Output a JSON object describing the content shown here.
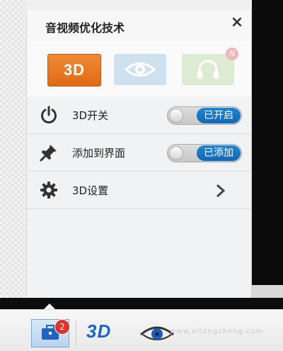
{
  "panel": {
    "title": "音视频优化技术",
    "close_label": "×",
    "tiles": [
      {
        "label": "3D",
        "icon": "3d-icon",
        "state": "active"
      },
      {
        "icon": "eye-icon",
        "state": "inactive"
      },
      {
        "icon": "headphones-icon",
        "state": "inactive",
        "badge": "N"
      }
    ],
    "rows": [
      {
        "icon": "power-icon",
        "label": "3D开关",
        "toggle_label": "已开启",
        "toggle_on": true
      },
      {
        "icon": "pin-icon",
        "label": "添加到界面",
        "toggle_label": "已添加",
        "toggle_on": true
      },
      {
        "icon": "gear-icon",
        "label": "3D设置",
        "action": "chevron-right-icon"
      }
    ]
  },
  "taskbar": {
    "badge_count": "2",
    "item_3d_label": "3D",
    "watermark": "www.xitongcheng.com"
  },
  "colors": {
    "accent_orange": "#e8772a",
    "toggle_blue": "#1a7acb",
    "badge_red": "#e0322b"
  }
}
